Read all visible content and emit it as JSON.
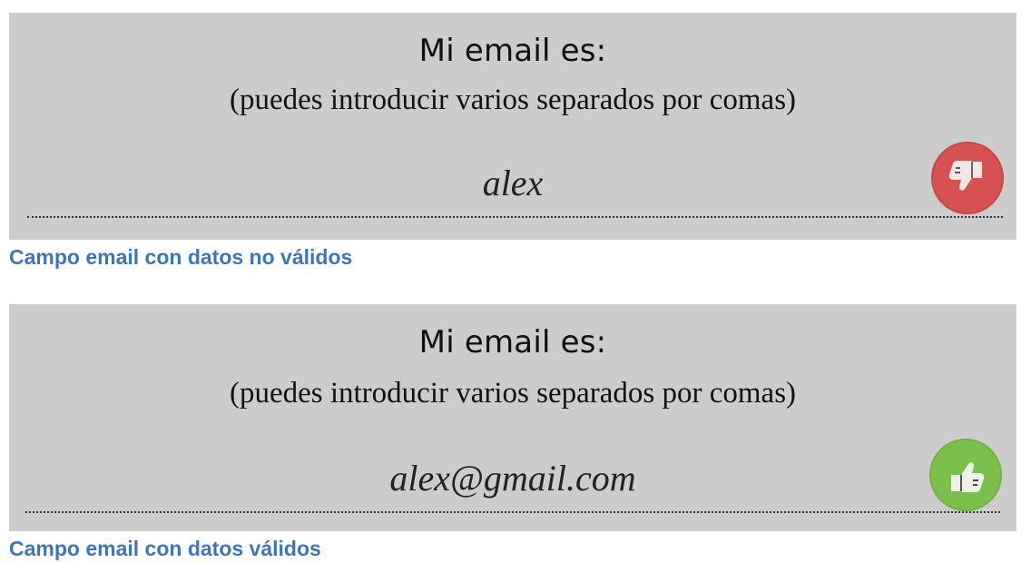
{
  "examples": [
    {
      "title": "Mi email es:",
      "subtitle": "(puedes introducir varios separados por comas)",
      "value": "alex",
      "status": "invalid",
      "status_icon": "thumbs-down-icon",
      "status_color": "#d65151",
      "caption": "Campo email con datos no válidos"
    },
    {
      "title": "Mi email es:",
      "subtitle": "(puedes introducir varios separados por comas)",
      "value": "alex@gmail.com",
      "status": "valid",
      "status_icon": "thumbs-up-icon",
      "status_color": "#7cbf4d",
      "caption": "Campo email con datos válidos"
    }
  ],
  "colors": {
    "panel_background": "#cccccc",
    "caption_text": "#3f76b7"
  }
}
